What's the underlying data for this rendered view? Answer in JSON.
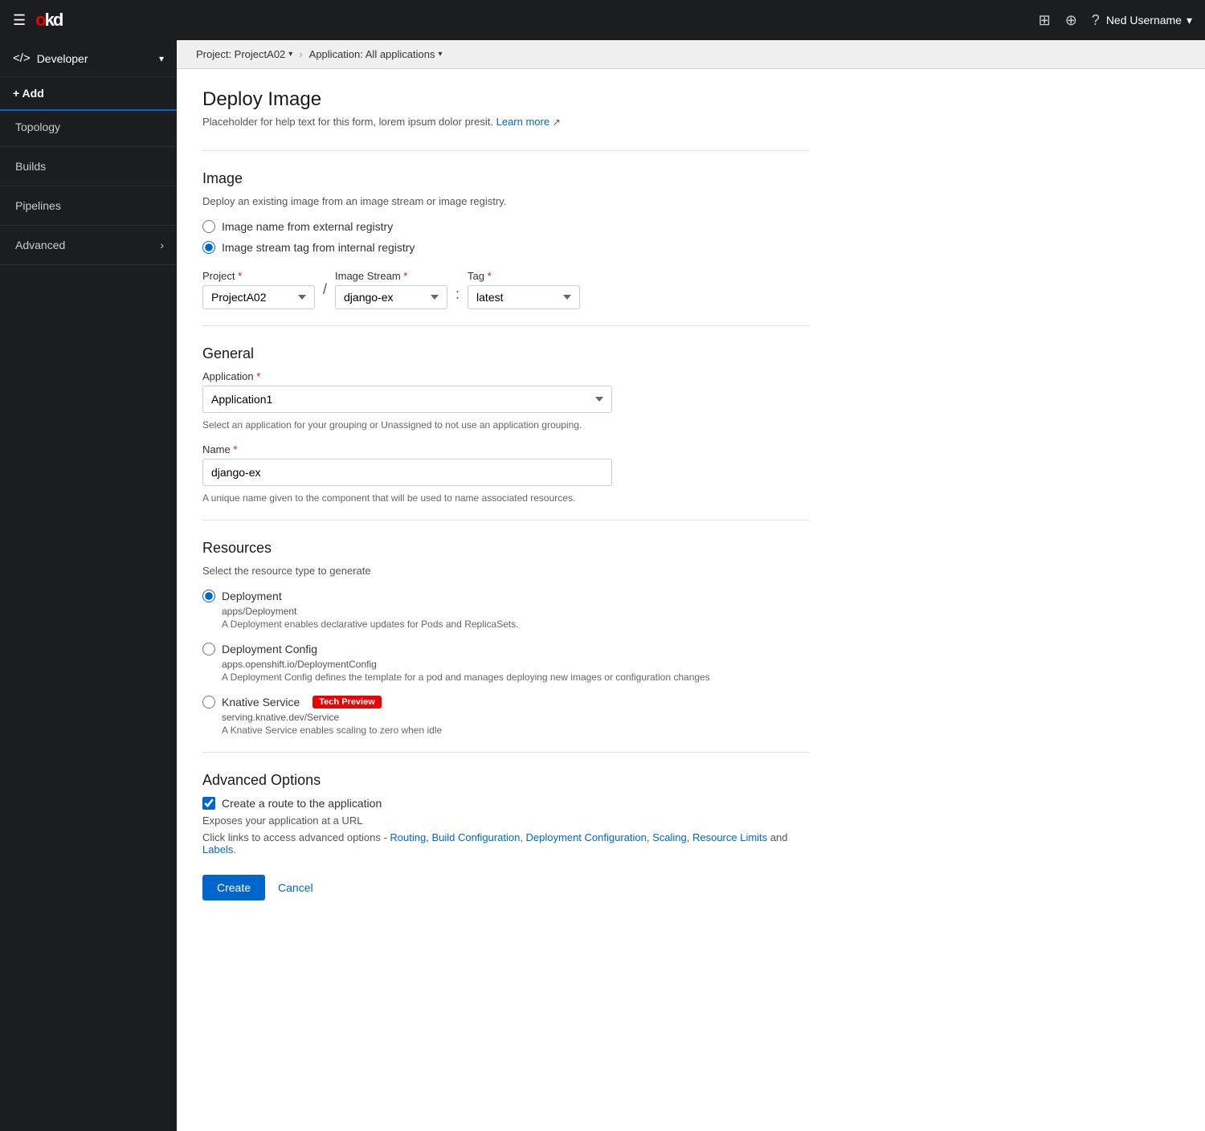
{
  "topnav": {
    "logo": "okd",
    "logo_prefix": "o",
    "logo_suffix": "kd",
    "user": "Ned Username",
    "icons": [
      "grid-icon",
      "plus-icon",
      "help-icon"
    ]
  },
  "sidebar": {
    "section": "Developer",
    "items": [
      {
        "label": "+ Add",
        "active": true
      },
      {
        "label": "Topology",
        "active": false
      },
      {
        "label": "Builds",
        "active": false
      },
      {
        "label": "Pipelines",
        "active": false
      },
      {
        "label": "Advanced",
        "active": false,
        "has_arrow": true
      }
    ]
  },
  "breadcrumb": {
    "project": "Project: ProjectA02",
    "application": "Application: All applications"
  },
  "page": {
    "title": "Deploy Image",
    "subtitle": "Placeholder for help text for this form, lorem ipsum dolor presit.",
    "learn_more": "Learn more"
  },
  "image_section": {
    "title": "Image",
    "description": "Deploy an existing image from an image stream or image registry.",
    "radio_external": "Image name from external registry",
    "radio_internal": "Image stream tag from internal registry",
    "project_label": "Project",
    "project_value": "ProjectA02",
    "image_stream_label": "Image Stream",
    "image_stream_value": "django-ex",
    "tag_label": "Tag",
    "tag_value": "latest"
  },
  "general_section": {
    "title": "General",
    "application_label": "Application",
    "application_value": "Application1",
    "application_desc": "Select an application for your grouping or Unassigned to not use an application grouping.",
    "name_label": "Name",
    "name_value": "django-ex",
    "name_desc": "A unique name given to the component that will be used to name associated resources."
  },
  "resources_section": {
    "title": "Resources",
    "description": "Select the resource type to generate",
    "options": [
      {
        "label": "Deployment",
        "sublabel": "apps/Deployment",
        "desc": "A Deployment enables declarative updates for Pods and ReplicaSets.",
        "selected": true,
        "tech_preview": false
      },
      {
        "label": "Deployment Config",
        "sublabel": "apps.openshift.io/DeploymentConfig",
        "desc": "A Deployment Config defines the template for a pod and manages deploying new images or configuration changes",
        "selected": false,
        "tech_preview": false
      },
      {
        "label": "Knative Service",
        "sublabel": "serving.knative.dev/Service",
        "desc": "A Knative Service enables scaling to zero when idle",
        "selected": false,
        "tech_preview": true,
        "tech_preview_label": "Tech Preview"
      }
    ]
  },
  "advanced_section": {
    "title": "Advanced Options",
    "checkbox_label": "Create a route to the application",
    "checkbox_checked": true,
    "expose_desc": "Exposes your application at a URL",
    "links_prefix": "Click links to access advanced options -",
    "links": [
      {
        "label": "Routing",
        "href": "#"
      },
      {
        "label": "Build Configuration",
        "href": "#"
      },
      {
        "label": "Deployment Configuration",
        "href": "#"
      },
      {
        "label": "Scaling",
        "href": "#"
      },
      {
        "label": "Resource Limits",
        "href": "#"
      }
    ],
    "links_suffix": "and",
    "labels_link": "Labels",
    "labels_href": "#"
  },
  "buttons": {
    "create": "Create",
    "cancel": "Cancel"
  }
}
